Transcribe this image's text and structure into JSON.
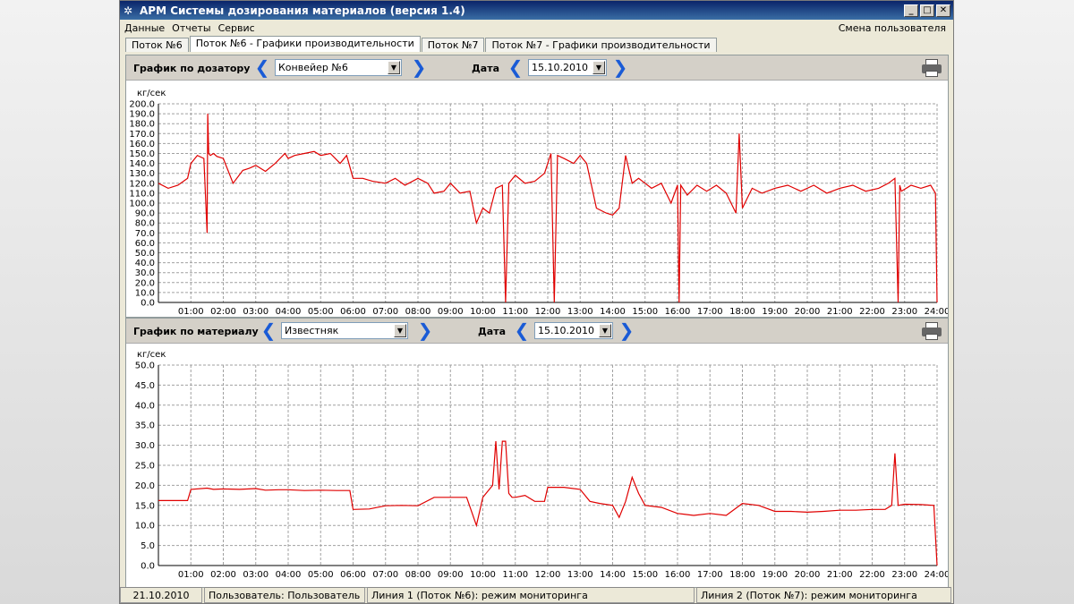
{
  "window": {
    "title": "АРМ Системы дозирования материалов (версия 1.4)",
    "controls": [
      "_",
      "□",
      "✕"
    ]
  },
  "menu": {
    "items": [
      "Данные",
      "Отчеты",
      "Сервис"
    ],
    "right": "Смена пользователя"
  },
  "tabs": [
    {
      "label": "Поток №6",
      "active": false
    },
    {
      "label": "Поток №6 - Графики производительности",
      "active": true
    },
    {
      "label": "Поток №7",
      "active": false
    },
    {
      "label": "Поток №7 - Графики производительности",
      "active": false
    }
  ],
  "top_panel": {
    "label": "График по дозатору",
    "combo_value": "Конвейер №6",
    "date_label": "Дата",
    "date_value": "15.10.2010",
    "unit": "кг/сек"
  },
  "bottom_panel": {
    "label": "График по материалу",
    "combo_value": "Известняк",
    "date_label": "Дата",
    "date_value": "15.10.2010",
    "unit": "кг/сек"
  },
  "status": {
    "date": "21.10.2010",
    "user": "Пользователь: Пользователь",
    "line1": "Линия 1 (Поток №6): режим мониторинга",
    "line2": "Линия 2 (Поток №7): режим мониторинга"
  },
  "colors": {
    "series": "#e00000",
    "grid": "#a0a0a0"
  },
  "chart_data": [
    {
      "type": "line",
      "ylabel": "кг/сек",
      "ylim": [
        0,
        200
      ],
      "yticks": [
        "0.0",
        "10.0",
        "20.0",
        "30.0",
        "40.0",
        "50.0",
        "60.0",
        "70.0",
        "80.0",
        "90.0",
        "100.0",
        "110.0",
        "120.0",
        "130.0",
        "140.0",
        "150.0",
        "160.0",
        "170.0",
        "180.0",
        "190.0",
        "200.0"
      ],
      "xticks": [
        "01:00",
        "02:00",
        "03:00",
        "04:00",
        "05:00",
        "06:00",
        "07:00",
        "08:00",
        "09:00",
        "10:00",
        "11:00",
        "12:00",
        "13:00",
        "14:00",
        "15:00",
        "16:00",
        "17:00",
        "18:00",
        "19:00",
        "20:00",
        "21:00",
        "22:00",
        "23:00",
        "24:00"
      ],
      "xlim": [
        0,
        24
      ],
      "grid": true,
      "series": [
        {
          "x": [
            0,
            0.3,
            0.6,
            0.9,
            1.0,
            1.2,
            1.4,
            1.5,
            1.52,
            1.55,
            1.6,
            1.7,
            1.8,
            2.0,
            2.3,
            2.6,
            2.8,
            3.0,
            3.3,
            3.6,
            3.9,
            4.0,
            4.2,
            4.5,
            4.8,
            5.0,
            5.3,
            5.6,
            5.8,
            6.0,
            6.3,
            6.6,
            7.0,
            7.3,
            7.6,
            8.0,
            8.3,
            8.5,
            8.8,
            9.0,
            9.3,
            9.6,
            9.8,
            10.0,
            10.2,
            10.4,
            10.6,
            10.7,
            10.8,
            11.0,
            11.3,
            11.6,
            11.9,
            12.0,
            12.1,
            12.2,
            12.3,
            12.5,
            12.8,
            13.0,
            13.2,
            13.5,
            13.8,
            14.0,
            14.2,
            14.4,
            14.6,
            14.8,
            15.0,
            15.2,
            15.5,
            15.8,
            16.0,
            16.05,
            16.1,
            16.3,
            16.6,
            16.9,
            17.2,
            17.5,
            17.8,
            17.9,
            18.0,
            18.3,
            18.6,
            19.0,
            19.4,
            19.8,
            20.2,
            20.6,
            21.0,
            21.4,
            21.8,
            22.2,
            22.5,
            22.7,
            22.8,
            22.85,
            22.9,
            23.2,
            23.5,
            23.8,
            23.95,
            24.0
          ],
          "y": [
            120,
            115,
            118,
            125,
            140,
            148,
            145,
            70,
            190,
            150,
            148,
            150,
            147,
            145,
            120,
            133,
            135,
            138,
            132,
            140,
            150,
            145,
            148,
            150,
            152,
            148,
            150,
            140,
            148,
            125,
            125,
            122,
            120,
            125,
            118,
            125,
            120,
            110,
            112,
            120,
            110,
            112,
            80,
            95,
            90,
            115,
            118,
            0,
            120,
            128,
            120,
            122,
            130,
            140,
            150,
            0,
            148,
            145,
            140,
            148,
            140,
            95,
            90,
            88,
            95,
            148,
            120,
            125,
            120,
            115,
            120,
            100,
            118,
            0,
            118,
            108,
            118,
            112,
            118,
            110,
            90,
            170,
            95,
            115,
            110,
            115,
            118,
            112,
            118,
            110,
            115,
            118,
            112,
            115,
            120,
            125,
            0,
            118,
            112,
            118,
            115,
            118,
            110,
            0
          ]
        }
      ]
    },
    {
      "type": "line",
      "ylabel": "кг/сек",
      "ylim": [
        0,
        50
      ],
      "yticks": [
        "0.0",
        "5.0",
        "10.0",
        "15.0",
        "20.0",
        "25.0",
        "30.0",
        "35.0",
        "40.0",
        "45.0",
        "50.0"
      ],
      "xticks": [
        "01:00",
        "02:00",
        "03:00",
        "04:00",
        "05:00",
        "06:00",
        "07:00",
        "08:00",
        "09:00",
        "10:00",
        "11:00",
        "12:00",
        "13:00",
        "14:00",
        "15:00",
        "16:00",
        "17:00",
        "18:00",
        "19:00",
        "20:00",
        "21:00",
        "22:00",
        "23:00",
        "24:00"
      ],
      "xlim": [
        0,
        24
      ],
      "grid": true,
      "series": [
        {
          "x": [
            0,
            0.5,
            0.9,
            1.0,
            1.5,
            1.7,
            2.0,
            2.5,
            3.0,
            3.3,
            3.7,
            4.0,
            4.5,
            5.0,
            5.5,
            5.9,
            6.0,
            6.5,
            7.0,
            7.5,
            8.0,
            8.5,
            9.0,
            9.5,
            9.8,
            10.0,
            10.3,
            10.4,
            10.5,
            10.6,
            10.7,
            10.8,
            10.9,
            11.0,
            11.3,
            11.6,
            11.9,
            12.0,
            12.5,
            13.0,
            13.3,
            13.6,
            14.0,
            14.2,
            14.4,
            14.6,
            14.8,
            15.0,
            15.5,
            16.0,
            16.5,
            17.0,
            17.5,
            18.0,
            18.5,
            19.0,
            19.5,
            20.0,
            20.5,
            21.0,
            21.5,
            22.0,
            22.4,
            22.6,
            22.7,
            22.8,
            23.0,
            23.5,
            23.9,
            24.0
          ],
          "y": [
            16.2,
            16.2,
            16.2,
            19.0,
            19.3,
            19.0,
            19.1,
            19.0,
            19.2,
            18.8,
            18.9,
            18.9,
            18.7,
            18.8,
            18.7,
            18.7,
            14.0,
            14.1,
            14.9,
            15.0,
            14.9,
            17.0,
            17.0,
            17.0,
            10.0,
            17.0,
            20.0,
            31.0,
            19.0,
            31.0,
            31.0,
            18.0,
            17.0,
            17.0,
            17.5,
            16.0,
            16.0,
            19.5,
            19.5,
            19.0,
            16.0,
            15.5,
            15.0,
            12.0,
            16.0,
            22.0,
            18.0,
            15.0,
            14.5,
            13.0,
            12.5,
            13.0,
            12.5,
            15.5,
            15.0,
            13.5,
            13.5,
            13.3,
            13.5,
            13.8,
            13.8,
            14.0,
            14.0,
            15.0,
            28.0,
            15.0,
            15.3,
            15.2,
            15.0,
            0
          ]
        }
      ]
    }
  ]
}
